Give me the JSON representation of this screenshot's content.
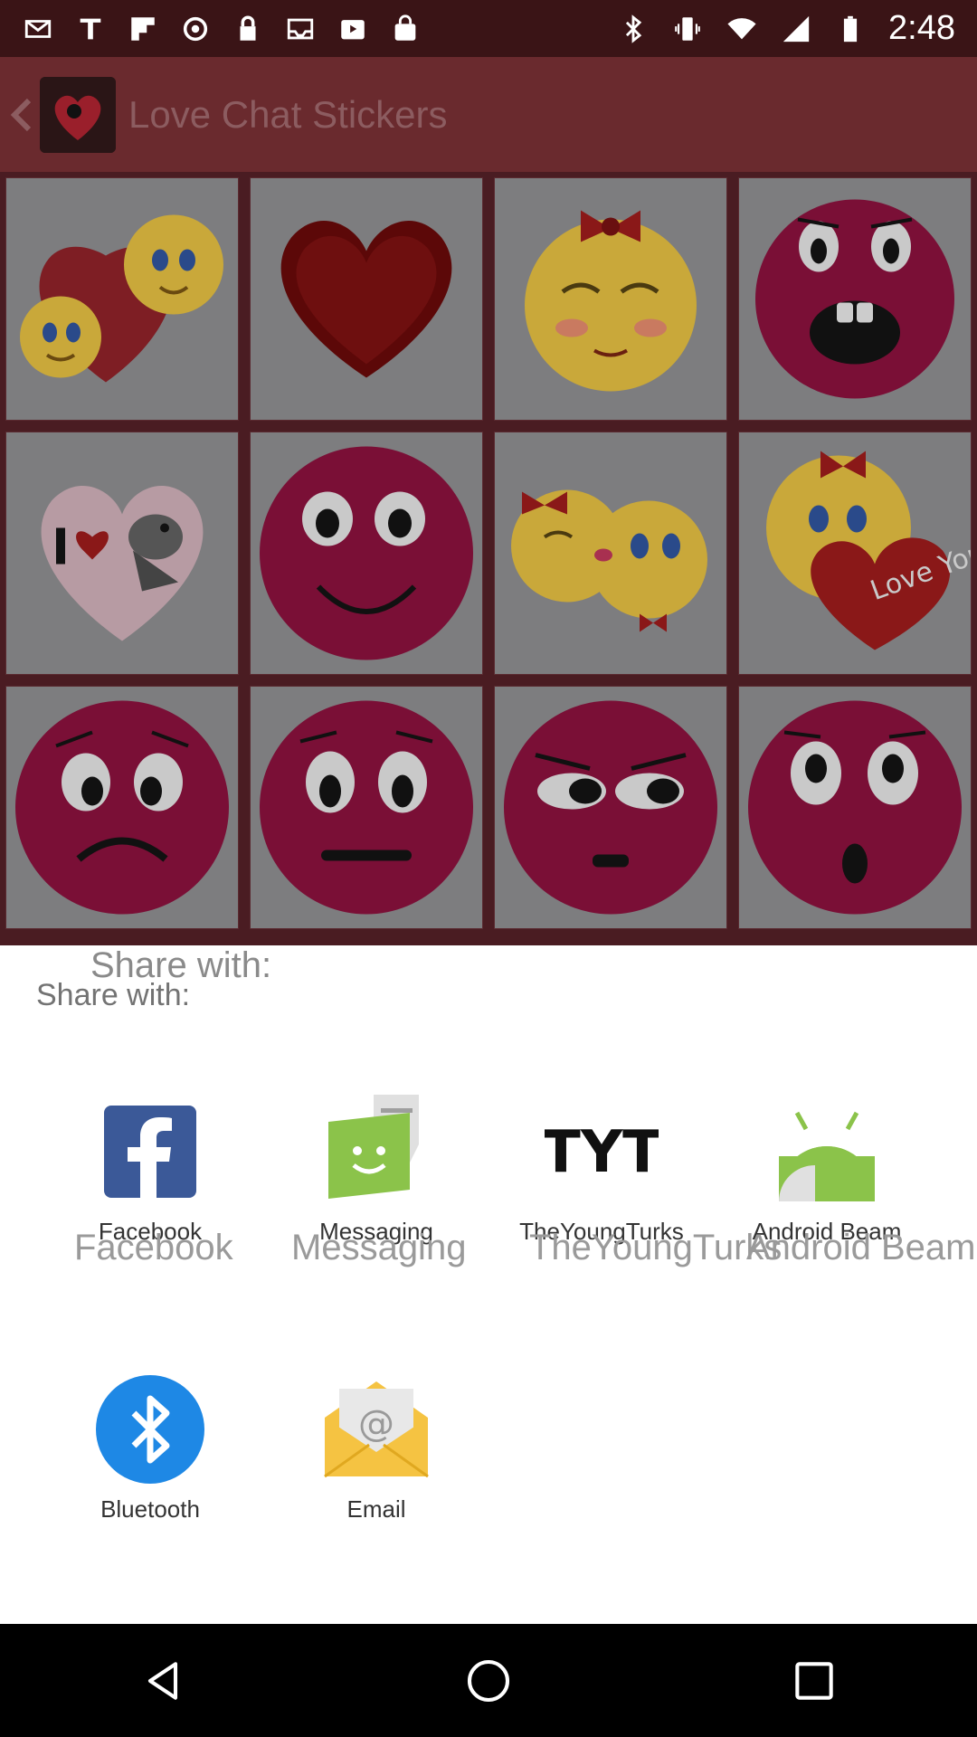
{
  "status_bar": {
    "time": "2:48",
    "left_icons": [
      "mail-icon",
      "text-tool-icon",
      "flipboard-icon",
      "sync-icon",
      "lock-icon",
      "inbox-icon",
      "play-store-icon",
      "shopping-bag-icon"
    ],
    "right_icons": [
      "bluetooth-icon",
      "vibrate-icon",
      "wifi-icon",
      "signal-icon",
      "battery-icon"
    ]
  },
  "app_bar": {
    "title": "Love Chat Stickers"
  },
  "stickers": [
    "be-mine-couple",
    "red-heart",
    "blushing-girl-emoji",
    "shocked-face",
    "i-love-parrot",
    "smiling-face",
    "kissing-emojis",
    "love-you-heart",
    "sad-face",
    "neutral-face",
    "annoyed-face",
    "surprised-face"
  ],
  "share": {
    "ghost_title": "Share with:",
    "title": "Share with:",
    "apps": [
      {
        "label": "Facebook",
        "icon": "facebook-icon"
      },
      {
        "label": "Messaging",
        "icon": "messaging-icon"
      },
      {
        "label": "TheYoungTurks",
        "icon": "tyt-icon"
      },
      {
        "label": "Android Beam",
        "icon": "android-beam-icon"
      },
      {
        "label": "Bluetooth",
        "icon": "bluetooth-app-icon"
      },
      {
        "label": "Email",
        "icon": "email-icon"
      }
    ],
    "ghost_labels": [
      "Facebook",
      "Messaging",
      "TheYoungTurks",
      "Android Beam"
    ],
    "icon_logo_text": "TYT"
  },
  "colors": {
    "facebook": "#3b5998",
    "messaging": "#8bc34a",
    "android": "#8bc34a",
    "bluetooth": "#1e88e5",
    "email": "#f5c342",
    "sticker_face": "#7a0f36"
  }
}
